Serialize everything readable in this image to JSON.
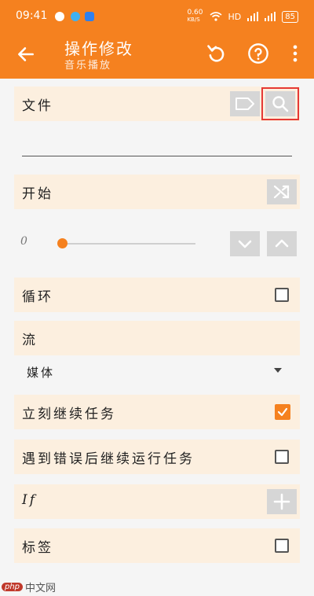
{
  "status_bar": {
    "time": "09:41",
    "network_speed": "0.60",
    "network_speed_unit": "KB/S",
    "signal_label": "HD",
    "battery": "85"
  },
  "toolbar": {
    "title": "操作修改",
    "subtitle": "音乐播放"
  },
  "file_row": {
    "label": "文件"
  },
  "start_row": {
    "label": "开始"
  },
  "seek": {
    "value": "0",
    "fraction": 0.0
  },
  "loop_row": {
    "label": "循环",
    "checked": false
  },
  "stream_row": {
    "label": "流"
  },
  "stream_select": {
    "value": "媒体"
  },
  "continue_row": {
    "label": "立刻继续任务",
    "checked": true
  },
  "error_row": {
    "label": "遇到错误后继续运行任务",
    "checked": false
  },
  "if_row": {
    "label": "If"
  },
  "tag_row": {
    "label": "标签",
    "checked": false
  },
  "watermark": {
    "badge": "php",
    "text": "中文网"
  },
  "colors": {
    "accent": "#f5811f",
    "row_bg": "#fcefdf",
    "highlight": "#e53935"
  }
}
